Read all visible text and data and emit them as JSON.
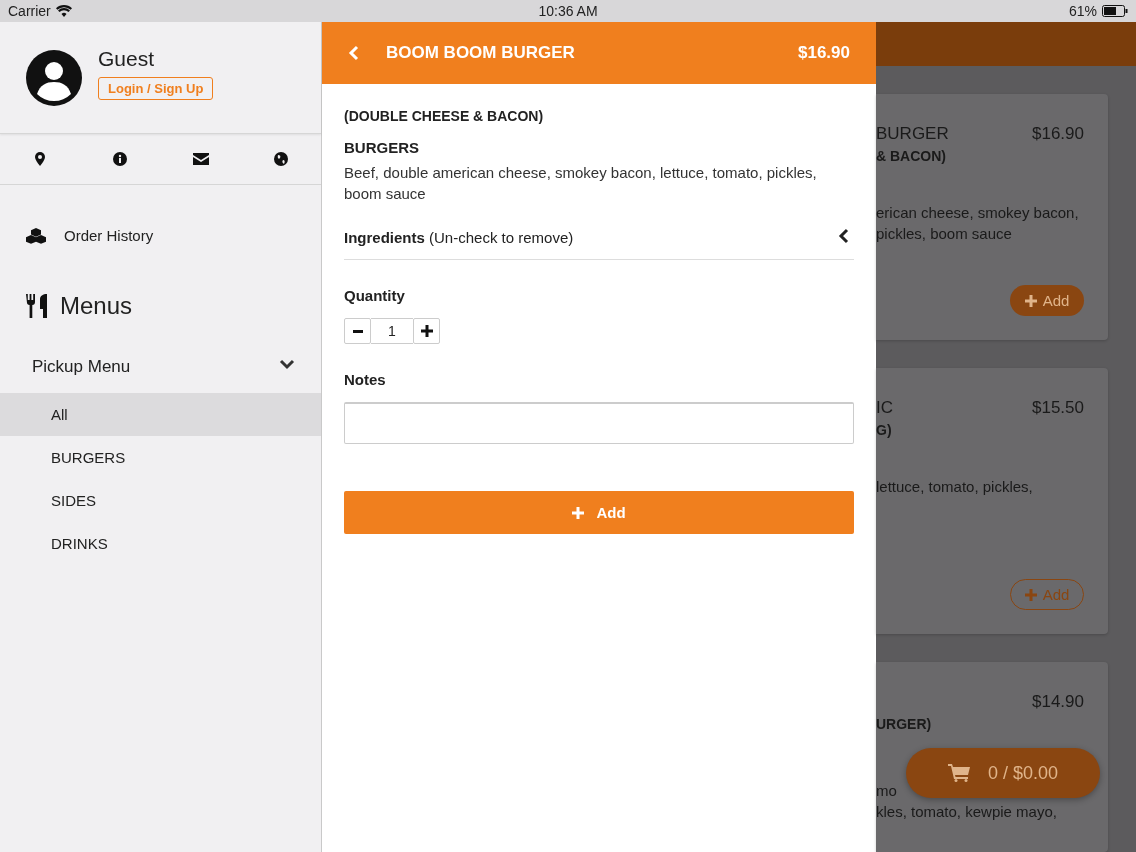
{
  "status_bar": {
    "carrier": "Carrier",
    "time": "10:36 AM",
    "battery": "61%"
  },
  "sidebar": {
    "user": {
      "name": "Guest",
      "login_button": "Login / Sign Up"
    },
    "order_history": "Order History",
    "menus_heading": "Menus",
    "menu": {
      "label": "Pickup Menu",
      "expanded": true,
      "items": [
        {
          "label": "All",
          "selected": true
        },
        {
          "label": "BURGERS",
          "selected": false
        },
        {
          "label": "SIDES",
          "selected": false
        },
        {
          "label": "DRINKS",
          "selected": false
        }
      ]
    }
  },
  "detail": {
    "title": "BOOM BOOM BURGER",
    "price": "$16.90",
    "subtitle": "(DOUBLE CHEESE & BACON)",
    "category": "BURGERS",
    "description": "Beef, double american cheese, smokey bacon, lettuce, tomato, pickles, boom sauce",
    "ingredients": {
      "label": "**Ingredients** (Un-check to remove)",
      "expanded": false
    },
    "quantity": {
      "label": "Quantity",
      "value": "1"
    },
    "notes": {
      "label": "Notes"
    },
    "add_button": "Add"
  },
  "background": {
    "cards": [
      {
        "title": "BURGER",
        "price": "$16.90",
        "subtitle": "& BACON)",
        "description_lines": [
          "erican cheese, smokey bacon,",
          "pickles, boom sauce"
        ],
        "add_button": "Add",
        "filled": true
      },
      {
        "title": "IC",
        "price": "$15.50",
        "subtitle": "G)",
        "description_lines": [
          "lettuce, tomato, pickles,"
        ],
        "add_button": "Add",
        "filled": false
      },
      {
        "price": "$14.90",
        "subtitle": "URGER)",
        "description_lines": [
          "mo",
          "kles, tomato, kewpie mayo,"
        ]
      }
    ],
    "cart": "0 / $0.00"
  }
}
